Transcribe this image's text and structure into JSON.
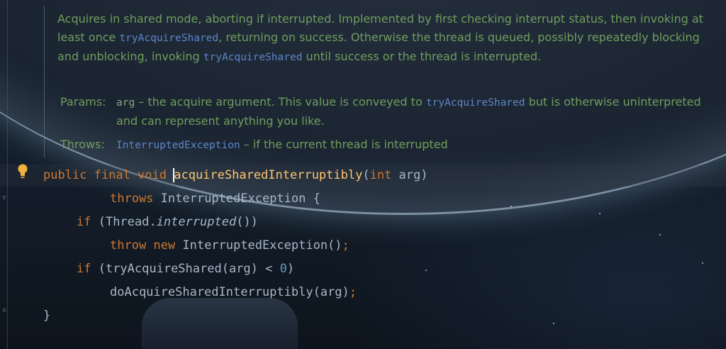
{
  "doc": {
    "summary": [
      {
        "t": "Acquires in shared mode, aborting if interrupted. Implemented by first checking interrupt status, then invoking at least once "
      },
      {
        "c": "tryAcquireShared"
      },
      {
        "t": ", returning on success. Otherwise the thread is queued, possibly repeatedly blocking and unblocking, invoking "
      },
      {
        "c": "tryAcquireShared"
      },
      {
        "t": " until success or the thread is interrupted."
      }
    ],
    "params_label": "Params:",
    "param_name": "arg",
    "param_text_1": " – the acquire argument. This value is conveyed to ",
    "param_link": "tryAcquireShared",
    "param_text_2": " but is otherwise uninterpreted and can represent anything you like.",
    "throws_label": "Throws:",
    "throws_link": "InterruptedException",
    "throws_text": " – if the current thread is interrupted"
  },
  "code": {
    "line1": {
      "kw": "public final void ",
      "fn": "acquireSharedInterruptibly",
      "open": "(",
      "kw2": "int",
      "rest": " arg)"
    },
    "line2": {
      "kw": "throws",
      "rest": " InterruptedException {"
    },
    "line3": {
      "kw": "if",
      "a": " (Thread.",
      "it": "interrupted",
      "b": "())"
    },
    "line4": {
      "kw": "throw new",
      "rest": " InterruptedException()",
      "semi": ";"
    },
    "line5": {
      "kw": "if",
      "a": " (tryAcquireShared(arg) < ",
      "num": "0",
      "b": ")"
    },
    "line6": {
      "rest": "doAcquireSharedInterruptibly(arg)",
      "semi": ";"
    },
    "line7": {
      "rest": "}"
    }
  },
  "colors": {
    "doc_text": "#6f9d5d",
    "doc_link": "#5d86c9",
    "keyword": "#cc7832",
    "method": "#ffc66d",
    "number": "#6897bb",
    "plain": "#a9b7c6"
  },
  "icons": {
    "intention": "lightbulb-icon",
    "fold": "fold-marker-icon"
  }
}
